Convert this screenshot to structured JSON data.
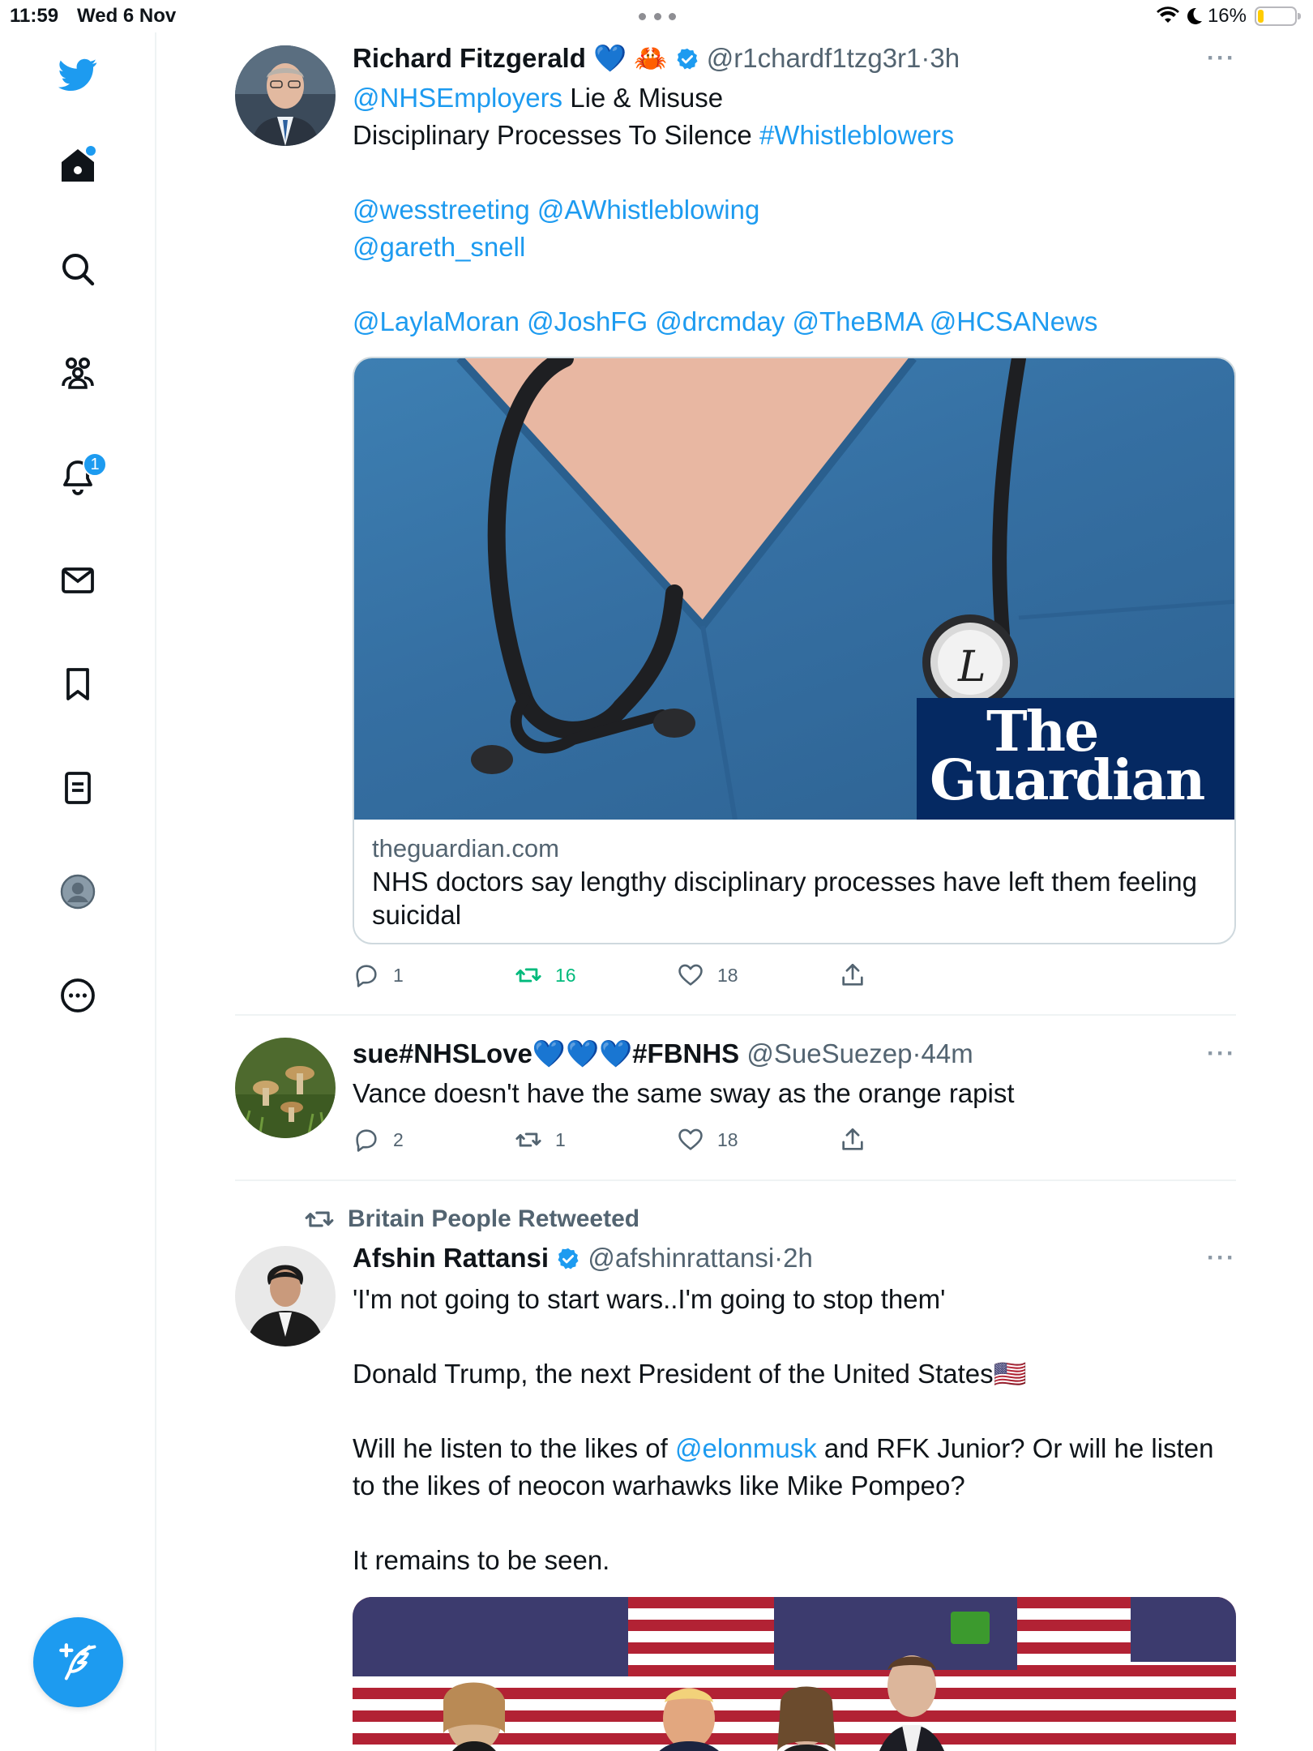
{
  "status_bar": {
    "time": "11:59",
    "date": "Wed 6 Nov",
    "battery": "16%",
    "battery_level": 0.16
  },
  "sidebar": {
    "notifications_badge": "1",
    "items": [
      "twitter-logo",
      "home",
      "search",
      "communities",
      "notifications",
      "messages",
      "bookmarks",
      "lists",
      "profile",
      "more"
    ]
  },
  "colors": {
    "accent": "#1d9bf0",
    "retweet_active": "#00ba7c",
    "guardian_blue": "#052962",
    "scrubs": "#3b7bb0"
  },
  "tweets": [
    {
      "name": "Richard Fitzgerald",
      "emoji": "💙 🦀",
      "handle": "@r1chardf1tzg3r1",
      "dot": "·",
      "time": "3h",
      "line1_link": "@NHSEmployers",
      "line1_text": " Lie & Misuse",
      "line2_text": "Disciplinary Processes To Silence ",
      "line2_link": "#Whistleblowers",
      "mentions1": "@wesstreeting @AWhistleblowing",
      "mentions2": "@gareth_snell",
      "mentions3": "@LaylaMoran @JoshFG @drcmday @TheBMA @HCSANews",
      "card": {
        "brand_line1": "The",
        "brand_line2": "Guardian",
        "domain": "theguardian.com",
        "title": "NHS doctors say lengthy disciplinary processes have left them feeling suicidal"
      },
      "replies": "1",
      "retweets": "16",
      "likes": "18"
    },
    {
      "name": "sue#NHSLove💙💙💙#FBNHS",
      "handle": "@SueSuezep",
      "dot": "·",
      "time": "44m",
      "text": "Vance doesn't have the same sway as the orange rapist",
      "replies": "2",
      "retweets": "1",
      "likes": "18"
    },
    {
      "retweeted_by": "Britain People Retweeted",
      "name": "Afshin Rattansi",
      "handle": "@afshinrattansi",
      "dot": "·",
      "time": "2h",
      "p1": "'I'm not going to start wars..I'm going to stop them'",
      "p2": "Donald Trump, the next President of the United States🇺🇸",
      "p3_a": "Will he listen to the likes of ",
      "p3_link": "@elonmusk",
      "p3_b": " and RFK Junior? Or will he listen to the likes of neocon warhawks like Mike Pompeo?",
      "p4": "It remains to be seen."
    }
  ]
}
